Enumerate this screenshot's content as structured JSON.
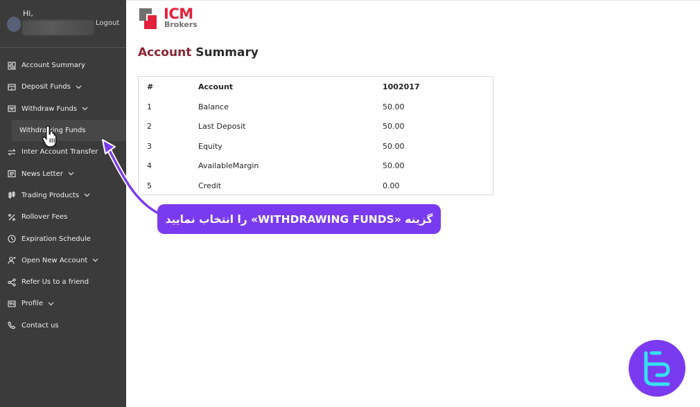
{
  "user": {
    "greeting": "Hi,",
    "logout_label": "Logout"
  },
  "brand": {
    "logo_text": "ICM",
    "logo_subtext": "Brokers",
    "accent_color": "#e2213c"
  },
  "sidebar": {
    "items": [
      {
        "label": "Account Summary",
        "icon": "grid-icon"
      },
      {
        "label": "Deposit Funds",
        "icon": "deposit-icon",
        "chevron": true
      },
      {
        "label": "Withdraw Funds",
        "icon": "withdraw-icon",
        "chevron": true
      },
      {
        "label": "Withdrawing Funds",
        "sub": true
      },
      {
        "label": "Inter Account Transfer",
        "icon": "transfer-icon"
      },
      {
        "label": "News Letter",
        "icon": "newsletter-icon",
        "chevron": true
      },
      {
        "label": "Trading Products",
        "icon": "candles-icon",
        "chevron": true
      },
      {
        "label": "Rollover Fees",
        "icon": "percent-icon"
      },
      {
        "label": "Expiration Schedule",
        "icon": "clock-icon"
      },
      {
        "label": "Open New Account",
        "icon": "add-user-icon",
        "chevron": true
      },
      {
        "label": "Refer Us to a friend",
        "icon": "share-icon"
      },
      {
        "label": "Profile",
        "icon": "profile-icon",
        "chevron": true
      },
      {
        "label": "Contact us",
        "icon": "phone-icon"
      }
    ]
  },
  "page": {
    "title_accent": "Account",
    "title_rest": " Summary"
  },
  "table": {
    "headers": [
      "#",
      "Account",
      "1002017"
    ],
    "rows": [
      [
        "1",
        "Balance",
        "50.00"
      ],
      [
        "2",
        "Last Deposit",
        "50.00"
      ],
      [
        "3",
        "Equity",
        "50.00"
      ],
      [
        "4",
        "AvailableMargin",
        "50.00"
      ],
      [
        "5",
        "Credit",
        "0.00"
      ]
    ]
  },
  "callout": {
    "text": "گزینه «WITHDRAWING FUNDS» را انتخاب نمایید",
    "color": "#7a3bf0"
  }
}
